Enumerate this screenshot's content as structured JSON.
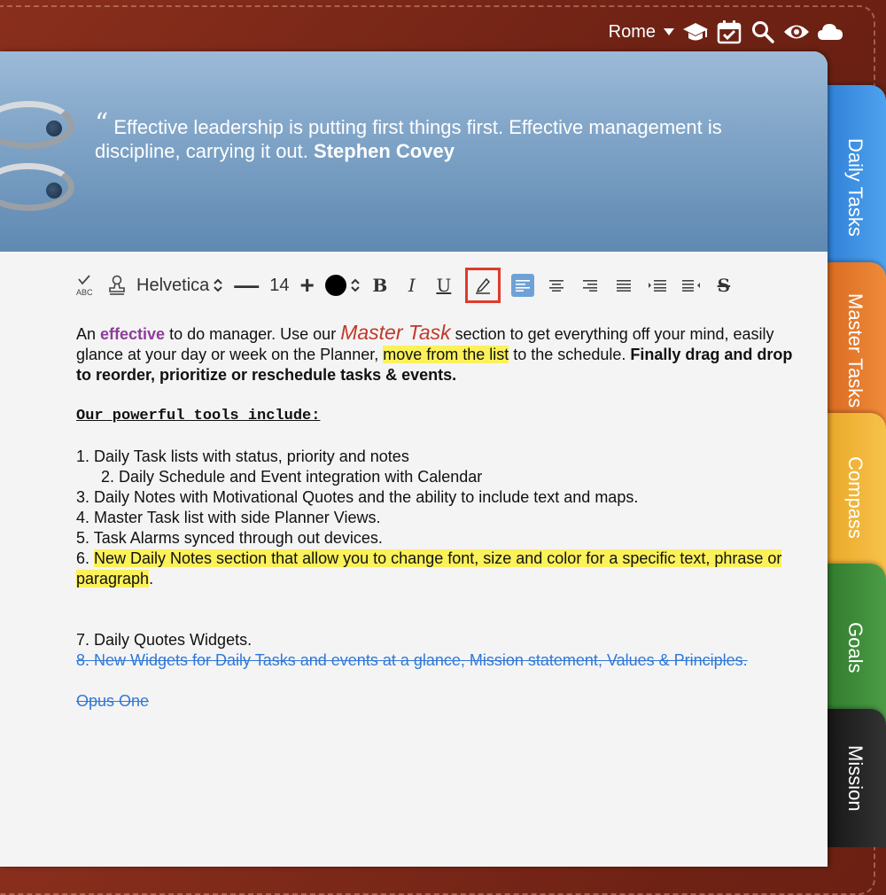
{
  "topbar": {
    "city": "Rome",
    "icons": [
      "dropdown-caret-icon",
      "graduation-cap-icon",
      "calendar-check-icon",
      "search-icon",
      "eye-icon",
      "cloud-icon"
    ]
  },
  "quote": {
    "text": "Effective leadership is putting first things first. Effective management is discipline, carrying it out.",
    "author": "Stephen Covey"
  },
  "toolbar": {
    "font_name": "Helvetica",
    "font_size": "14",
    "minus": "—",
    "plus": "+",
    "bold": "B",
    "italic": "I",
    "underline": "U",
    "strikethrough": "S",
    "text_color": "#000000"
  },
  "content": {
    "p1_a": "An ",
    "p1_effective": "effective",
    "p1_b": " to do manager. Use our ",
    "p1_master": "Master Task",
    "p1_c": " section to get everything off your mind, easily glance at your day or week on the Planner, ",
    "p1_hl": "move from the list",
    "p1_d": " to the schedule. ",
    "p1_bold": "Finally drag and drop to reorder, prioritize or reschedule tasks & events.",
    "heading": "Our powerful tools include:",
    "item1": "1. Daily Task lists with status, priority and notes",
    "item2": "2. Daily Schedule and Event integration with Calendar",
    "item3": "3. Daily Notes with Motivational Quotes and the ability to include text and maps.",
    "item4": "4. Master Task list with side Planner Views.",
    "item5": "5. Task Alarms synced through out devices.",
    "item6_num": "6. ",
    "item6_hl": "New Daily Notes section that allow you to change font, size and color for a specific text, phrase or paragraph",
    "item6_end": ".",
    "item7": "7. Daily Quotes Widgets.",
    "item8": "8. New Widgets for Daily Tasks and events at a glance, Mission statement, Values & Principles.",
    "signature": "Opus One"
  },
  "tabs": [
    {
      "label": "Daily Tasks",
      "color": "#3b8fe0"
    },
    {
      "label": "Master Tasks",
      "color": "#e8782a"
    },
    {
      "label": "Compass",
      "color": "#f2b636"
    },
    {
      "label": "Goals",
      "color": "#3f8f3a"
    },
    {
      "label": "Mission",
      "color": "#222222"
    }
  ]
}
